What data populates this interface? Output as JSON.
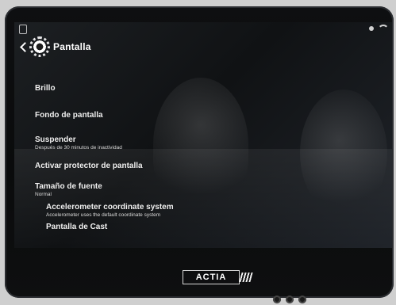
{
  "header": {
    "title": "Pantalla"
  },
  "settings": {
    "items": [
      {
        "title": "Brillo",
        "subtitle": ""
      },
      {
        "title": "Fondo de pantalla",
        "subtitle": ""
      },
      {
        "title": "Suspender",
        "subtitle": "Después de 30 minutos de inactividad"
      },
      {
        "title": "Activar protector de pantalla",
        "subtitle": ""
      },
      {
        "title": "Tamaño de fuente",
        "subtitle": "Normal"
      },
      {
        "title": "Accelerometer coordinate system",
        "subtitle": "Accelerometer uses the default coordinate system"
      },
      {
        "title": "Pantalla de Cast",
        "subtitle": ""
      }
    ]
  },
  "device": {
    "brand": "ACTIA"
  }
}
